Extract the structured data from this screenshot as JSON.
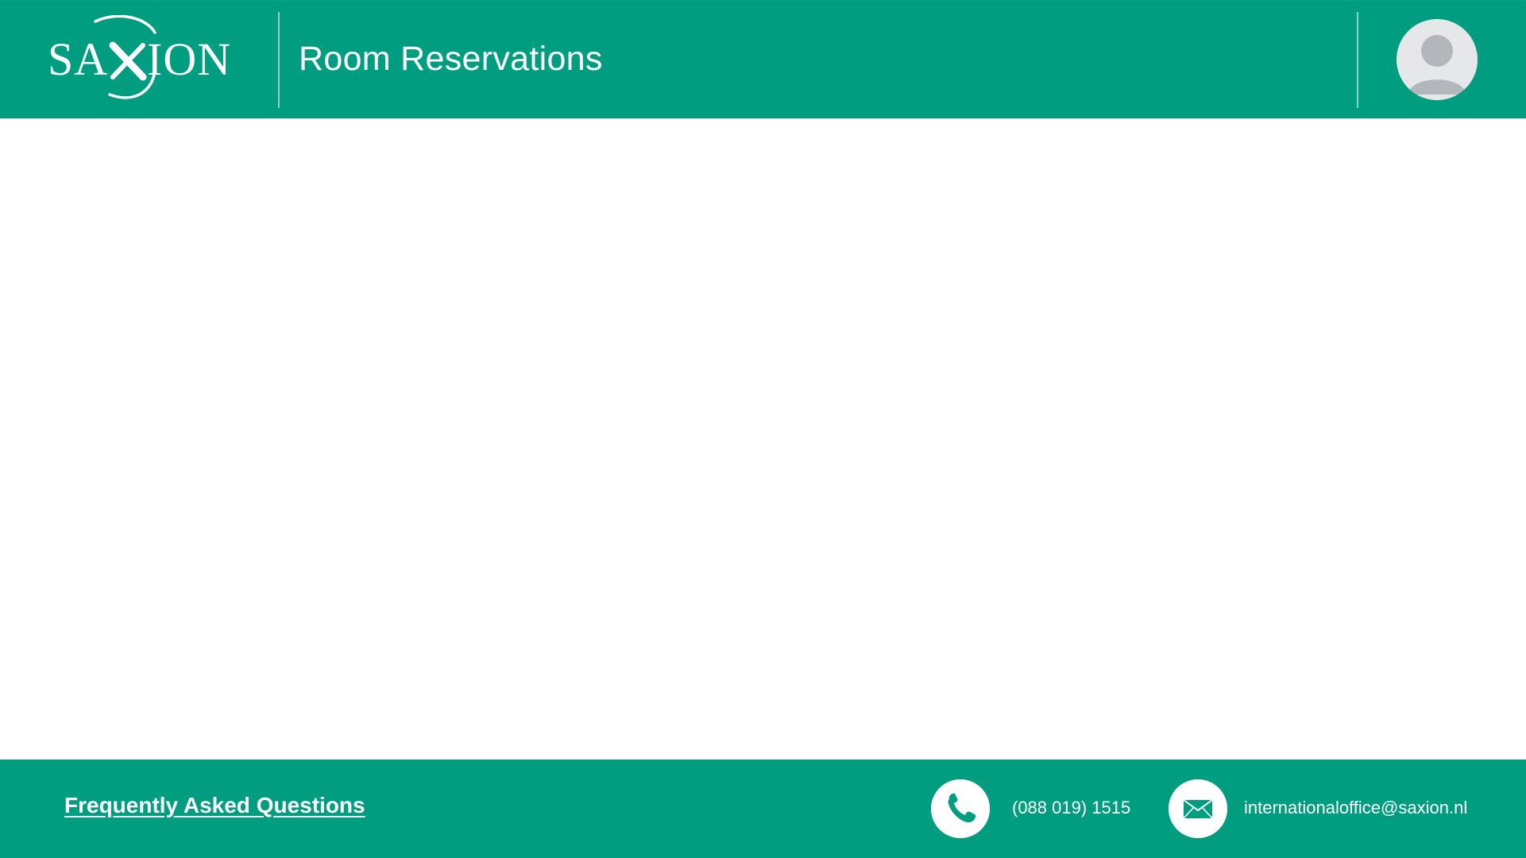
{
  "header": {
    "logo_text": "SAXION",
    "app_title": "Room Reservations",
    "avatar_icon": "user-avatar-icon"
  },
  "footer": {
    "faq_label": "Frequently Asked Questions",
    "phone": {
      "icon": "phone-icon",
      "text": "(088 019) 1515"
    },
    "email": {
      "icon": "mail-icon",
      "text": "internationaloffice@saxion.nl"
    }
  },
  "colors": {
    "brand_green": "#009d80",
    "avatar_bg": "#e6e7e8",
    "avatar_fg": "#b3b6ba",
    "white": "#ffffff"
  }
}
